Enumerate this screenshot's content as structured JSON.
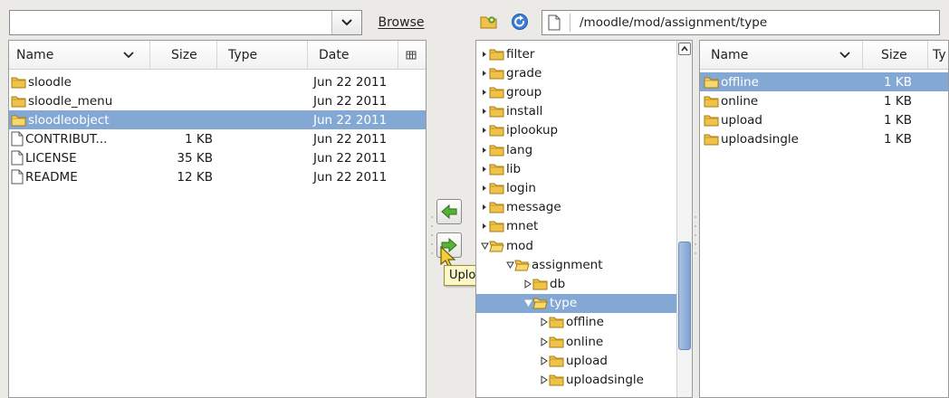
{
  "toolbar": {
    "browse_label": "Browse",
    "remote_path": "/moodle/mod/assignment/type"
  },
  "local": {
    "headers": {
      "name": "Name",
      "size": "Size",
      "type": "Type",
      "date": "Date"
    },
    "rows": [
      {
        "name": "sloodle",
        "size": "",
        "date": "Jun 22 2011",
        "kind": "folder"
      },
      {
        "name": "sloodle_menu",
        "size": "",
        "date": "Jun 22 2011",
        "kind": "folder"
      },
      {
        "name": "sloodleobject",
        "size": "",
        "date": "Jun 22 2011",
        "kind": "folder",
        "selected": true
      },
      {
        "name": "CONTRIBUT...",
        "size": "1 KB",
        "date": "Jun 22 2011",
        "kind": "file"
      },
      {
        "name": "LICENSE",
        "size": "35 KB",
        "date": "Jun 22 2011",
        "kind": "file"
      },
      {
        "name": "README",
        "size": "12 KB",
        "date": "Jun 22 2011",
        "kind": "file"
      }
    ]
  },
  "tree": {
    "items": [
      {
        "label": "filter",
        "state": "collapsed"
      },
      {
        "label": "grade",
        "state": "collapsed"
      },
      {
        "label": "group",
        "state": "collapsed"
      },
      {
        "label": "install",
        "state": "collapsed"
      },
      {
        "label": "iplookup",
        "state": "collapsed"
      },
      {
        "label": "lang",
        "state": "collapsed"
      },
      {
        "label": "lib",
        "state": "collapsed"
      },
      {
        "label": "login",
        "state": "collapsed"
      },
      {
        "label": "message",
        "state": "collapsed"
      },
      {
        "label": "mnet",
        "state": "collapsed"
      },
      {
        "label": "mod",
        "state": "expanded"
      },
      {
        "label": "assignment",
        "state": "expanded"
      },
      {
        "label": "db",
        "state": "collapsed"
      },
      {
        "label": "type",
        "state": "expanded",
        "selected": true
      },
      {
        "label": "offline",
        "state": "collapsed"
      },
      {
        "label": "online",
        "state": "collapsed"
      },
      {
        "label": "upload",
        "state": "collapsed"
      },
      {
        "label": "uploadsingle",
        "state": "collapsed"
      }
    ]
  },
  "remote": {
    "headers": {
      "name": "Name",
      "size": "Size",
      "type": "Ty"
    },
    "rows": [
      {
        "name": "offline",
        "size": "1 KB",
        "selected": true
      },
      {
        "name": "online",
        "size": "1 KB"
      },
      {
        "name": "upload",
        "size": "1 KB"
      },
      {
        "name": "uploadsingle",
        "size": "1 KB"
      }
    ]
  },
  "tooltip": {
    "text": "Upload"
  },
  "icons": {
    "folder": "folder-icon",
    "file": "file-icon",
    "download": "download-arrow-icon",
    "upload": "upload-arrow-icon",
    "refresh": "refresh-icon",
    "new_folder": "new-folder-icon",
    "column_picker": "column-picker-icon"
  },
  "colors": {
    "selection": "#84a8d4",
    "folder": "#f0c24a",
    "tooltip_bg": "#fbf7c6"
  }
}
